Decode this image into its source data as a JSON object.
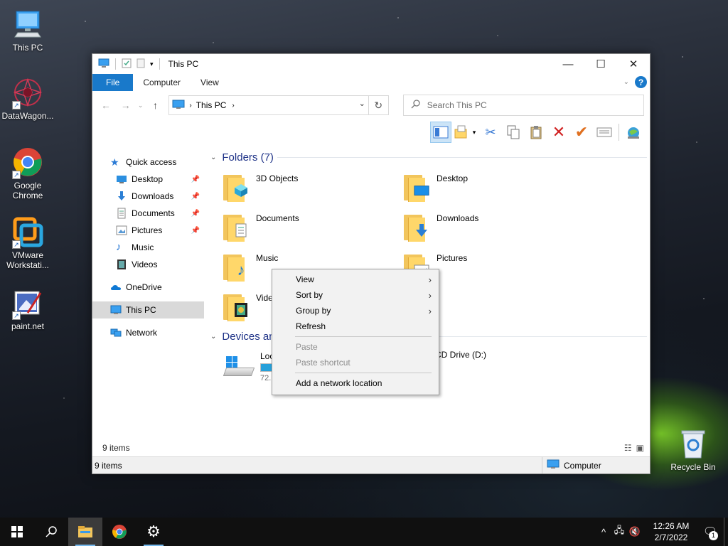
{
  "desktop": {
    "icons": [
      {
        "label": "This PC",
        "icon": "monitor-icon"
      },
      {
        "label": "DataWagon...",
        "icon": "datawagon-icon"
      },
      {
        "label": "Google Chrome",
        "icon": "chrome-icon"
      },
      {
        "label": "VMware Workstati...",
        "icon": "vmware-icon"
      },
      {
        "label": "paint.net",
        "icon": "paintnet-icon"
      },
      {
        "label": "Recycle Bin",
        "icon": "recycle-bin-icon"
      }
    ]
  },
  "window": {
    "title": "This PC",
    "ribbon_tabs": [
      "File",
      "Computer",
      "View"
    ],
    "address": {
      "crumb": "This PC"
    },
    "search": {
      "placeholder": "Search This PC"
    },
    "nav": {
      "quick_access": "Quick access",
      "items": [
        {
          "label": "Desktop",
          "pinned": true
        },
        {
          "label": "Downloads",
          "pinned": true
        },
        {
          "label": "Documents",
          "pinned": true
        },
        {
          "label": "Pictures",
          "pinned": true
        },
        {
          "label": "Music",
          "pinned": false
        },
        {
          "label": "Videos",
          "pinned": false
        }
      ],
      "onedrive": "OneDrive",
      "this_pc": "This PC",
      "network": "Network"
    },
    "folders_header": "Folders (7)",
    "folders": [
      {
        "name": "3D Objects",
        "icon": "3d-objects-icon"
      },
      {
        "name": "Desktop",
        "icon": "desktop-icon"
      },
      {
        "name": "Documents",
        "icon": "documents-icon"
      },
      {
        "name": "Downloads",
        "icon": "downloads-icon"
      },
      {
        "name": "Music",
        "icon": "music-icon"
      },
      {
        "name": "Pictures",
        "icon": "pictures-icon"
      },
      {
        "name": "Vide",
        "icon": "videos-icon"
      }
    ],
    "devices_header": "Devices an",
    "devices": {
      "local": {
        "label": "Loc",
        "sub": "72.1",
        "usage_fraction": 0.45
      },
      "cd": {
        "label": "CD Drive (D:)"
      }
    },
    "status_count": "9 items",
    "status_bar": {
      "items": "9 items",
      "location": "Computer"
    }
  },
  "context_menu": {
    "items": [
      {
        "label": "View",
        "submenu": true,
        "disabled": false
      },
      {
        "label": "Sort by",
        "submenu": true,
        "disabled": false
      },
      {
        "label": "Group by",
        "submenu": true,
        "disabled": false
      },
      {
        "label": "Refresh",
        "submenu": false,
        "disabled": false
      },
      {
        "label": "Paste",
        "submenu": false,
        "disabled": true
      },
      {
        "label": "Paste shortcut",
        "submenu": false,
        "disabled": true
      },
      {
        "label": "Add a network location",
        "submenu": false,
        "disabled": false
      }
    ]
  },
  "taskbar": {
    "clock_time": "12:26 AM",
    "clock_date": "2/7/2022",
    "notification_count": "1"
  },
  "colors": {
    "accent": "#1979ca",
    "folder_header": "#1e3287",
    "selected_nav": "#d9d9d9"
  }
}
